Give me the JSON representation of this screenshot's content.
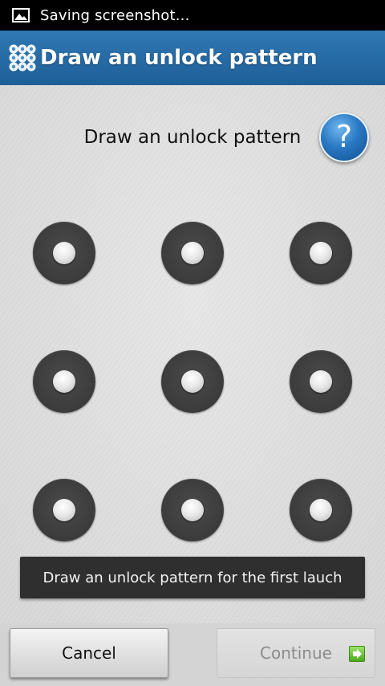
{
  "status_bar": {
    "icon": "image-icon",
    "text": "Saving screenshot..."
  },
  "title_bar": {
    "icon": "pattern-grid-icon",
    "title": "Draw an unlock pattern"
  },
  "content": {
    "instruction": "Draw an unlock pattern",
    "help_button": {
      "icon": "help-question-icon",
      "glyph": "?"
    },
    "pattern_dots": [
      1,
      2,
      3,
      4,
      5,
      6,
      7,
      8,
      9
    ],
    "toast": "Draw an unlock pattern for the first lauch"
  },
  "buttons": {
    "cancel_label": "Cancel",
    "continue_label": "Continue",
    "continue_icon": "arrow-right-icon"
  },
  "colors": {
    "title_bar": "#2a6fa9",
    "status_bar": "#000000",
    "accent": "#2a79c4"
  }
}
